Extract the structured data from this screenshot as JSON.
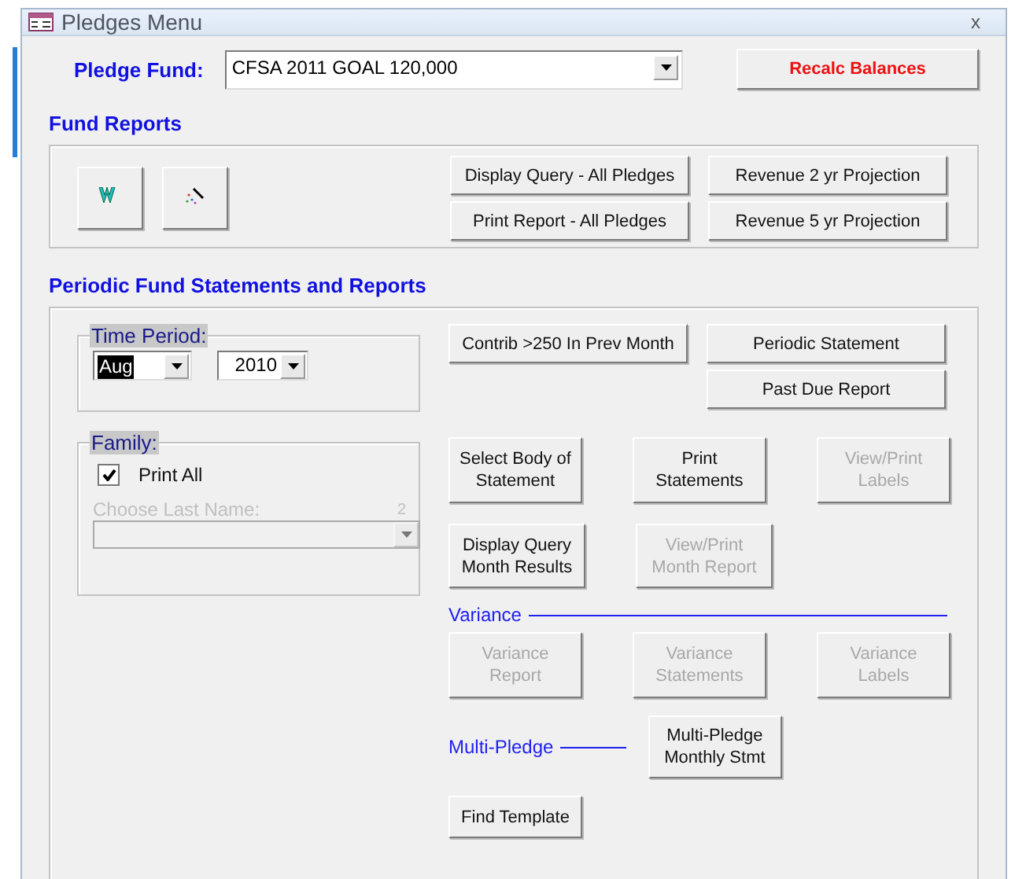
{
  "window": {
    "title": "Pledges Menu",
    "close": "x"
  },
  "pledge_fund": {
    "label": "Pledge Fund:",
    "value": "CFSA 2011 GOAL 120,000"
  },
  "recalc_button": {
    "label": "Recalc Balances"
  },
  "fund_reports": {
    "title": "Fund Reports",
    "buttons": [
      {
        "label": "Display Query - All Pledges"
      },
      {
        "label": "Revenue 2 yr Projection"
      },
      {
        "label": "Print Report - All Pledges"
      },
      {
        "label": "Revenue 5 yr Projection"
      }
    ]
  },
  "periodic": {
    "title": "Periodic Fund Statements and Reports",
    "time_period": {
      "label": "Time Period:",
      "month": "Aug",
      "year": "2010"
    },
    "family": {
      "label": "Family:",
      "print_all": {
        "label": "Print All",
        "checked": true
      },
      "last_name": {
        "label": "Choose Last Name:",
        "count": "2",
        "disabled": true
      }
    },
    "top_buttons": [
      {
        "label": "Contrib >250 In Prev Month",
        "disabled": false
      },
      {
        "label": "Periodic Statement",
        "disabled": false
      },
      {
        "label": "Past Due Report",
        "disabled": false
      }
    ],
    "statement_buttons": [
      {
        "label": "Select Body of Statement",
        "disabled": false
      },
      {
        "label": "Print Statements",
        "disabled": false
      },
      {
        "label": "View/Print Labels",
        "disabled": true
      }
    ],
    "month_buttons": [
      {
        "label": "Display Query Month Results",
        "disabled": false
      },
      {
        "label": "View/Print Month Report",
        "disabled": true
      }
    ],
    "variance": {
      "label": "Variance",
      "buttons": [
        {
          "label": "Variance Report",
          "disabled": true
        },
        {
          "label": "Variance Statements",
          "disabled": true
        },
        {
          "label": "Variance Labels",
          "disabled": true
        }
      ]
    },
    "multi_pledge": {
      "label": "Multi-Pledge",
      "button": {
        "label": "Multi-Pledge Monthly Stmt",
        "disabled": false
      }
    },
    "find_template": {
      "label": "Find Template",
      "disabled": false
    }
  }
}
